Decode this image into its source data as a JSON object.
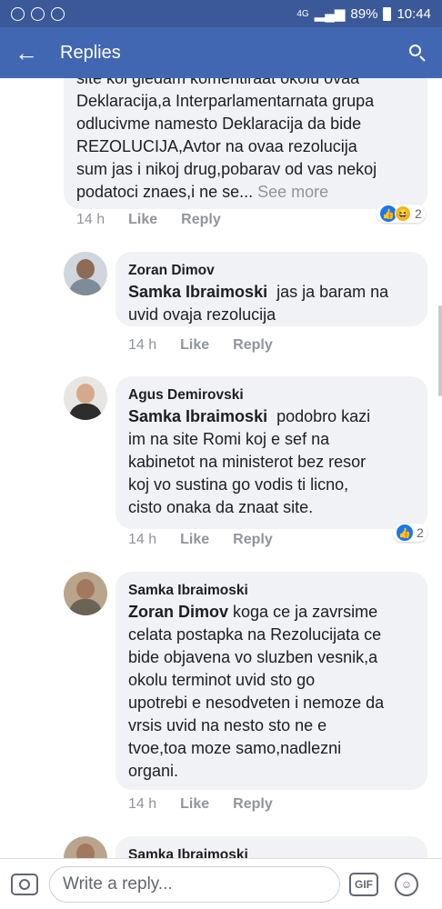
{
  "statusbar": {
    "network": "4G",
    "battery": "89%",
    "time": "10:44"
  },
  "appbar": {
    "title": "Replies"
  },
  "comments": [
    {
      "lines": [
        "site koi gledam komentiraat okolu ovaa",
        "Deklaracija,a Interparlamentarnata grupa",
        "odlucivme namesto Deklaracija da bide",
        "REZOLUCIJA,Avtor na ovaa rezolucija",
        "sum jas i nikoj drug,pobarav od vas nekoj",
        "podatoci znaes,i ne se..."
      ],
      "see_more": "See more",
      "time": "14 h",
      "like": "Like",
      "reply": "Reply",
      "reactions": "2"
    },
    {
      "author": "Zoran Dimov",
      "mention": "Samka Ibraimoski",
      "text_first": "jas ja baram na",
      "text_rest": [
        "uvid ovaja rezolucija"
      ],
      "time": "14 h",
      "like": "Like",
      "reply": "Reply"
    },
    {
      "author": "Agus Demirovski",
      "mention": "Samka Ibraimoski",
      "text_first": "podobro kazi",
      "text_rest": [
        "im na site Romi koj e sef na",
        "kabinetot na ministerot bez resor",
        "koj vo sustina go vodis ti licno,",
        "cisto onaka da znaat site."
      ],
      "time": "14 h",
      "like": "Like",
      "reply": "Reply",
      "reactions": "2"
    },
    {
      "author": "Samka Ibraimoski",
      "mention": "Zoran Dimov",
      "text_first": "koga ce ja zavrsime",
      "text_rest": [
        "celata postapka na Rezolucijata ce",
        "bide objavena vo sluzben vesnik,a",
        "okolu terminot uvid sto go",
        "upotrebi e nesodveten i nemoze da",
        "vrsis uvid na nesto sto ne e",
        "tvoe,toa moze samo,nadlezni",
        "organi."
      ],
      "time": "14 h",
      "like": "Like",
      "reply": "Reply"
    },
    {
      "author": "Samka Ibraimoski"
    }
  ],
  "composer": {
    "placeholder": "Write a reply...",
    "gif": "GIF"
  }
}
